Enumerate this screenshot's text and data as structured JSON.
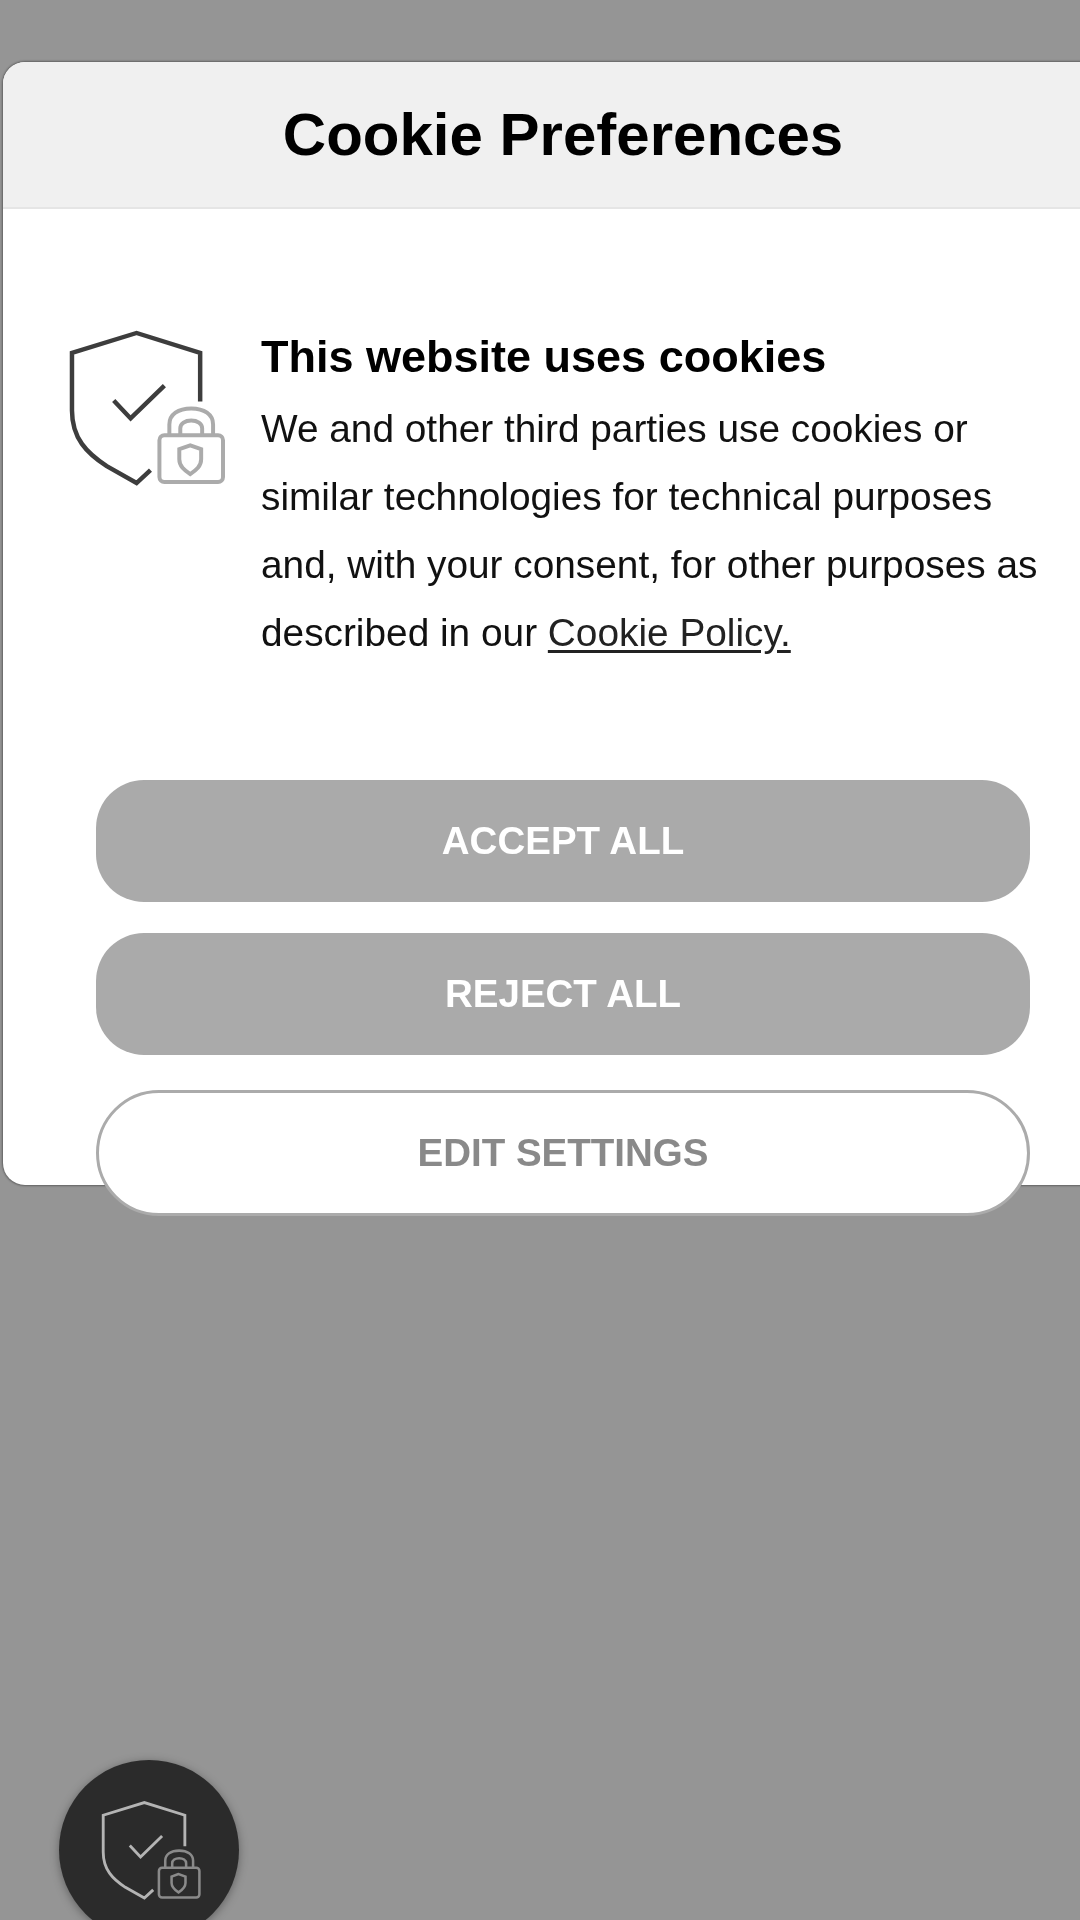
{
  "dialog": {
    "title": "Cookie Preferences",
    "heading": "This website uses cookies",
    "body": "We and other third parties use cookies or similar technologies for technical purposes and, with your consent, for other purposes as described in our",
    "link": "Cookie Policy.",
    "buttons": [
      {
        "label": "ACCEPT ALL",
        "kind": "filled"
      },
      {
        "label": "REJECT ALL",
        "kind": "filled"
      },
      {
        "label": "EDIT SETTINGS",
        "kind": "outlined"
      }
    ]
  }
}
